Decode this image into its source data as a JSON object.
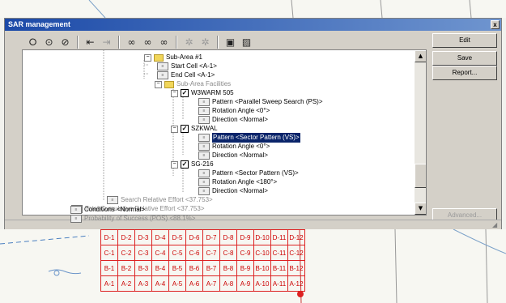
{
  "window": {
    "title": "SAR management",
    "close_glyph": "x"
  },
  "toolbar": {
    "icons": [
      "circle-icon",
      "copy-circle-icon",
      "delete-circle-icon",
      "import-icon",
      "export-icon",
      "binoculars-icon",
      "binoculars-add-icon",
      "binoculars-remove-icon",
      "snowflake-icon",
      "snowflake-dim-icon",
      "panel-icon",
      "panel-edit-icon"
    ]
  },
  "tree": {
    "sub_area": "Sub-Area #1",
    "start_cell": "Start Cell <A-1>",
    "end_cell": "End Cell <A-1>",
    "facilities": "Sub-Area Facilities",
    "f1": {
      "name": "W3WARM 505",
      "pattern": "Pattern <Parallel Sweep Search (PS)>",
      "rotation": "Rotation Angle <0°>",
      "direction": "Direction <Normal>"
    },
    "f2": {
      "name": "SZKWAL",
      "pattern": "Pattern <Sector Pattern (VS)>",
      "rotation": "Rotation Angle <0°>",
      "direction": "Direction <Normal>"
    },
    "f3": {
      "name": "SG-216",
      "pattern": "Pattern <Sector Pattern (VS)>",
      "rotation": "Rotation Angle <180°>",
      "direction": "Direction <Normal>"
    },
    "search_effort": "Search Relative Effort <37.753>",
    "total_effort": "Total Cumulative Relative Effort <37.753>",
    "conditions": "Conditions <Normal>",
    "pos": "Probability of Success (POS) <88.1%>"
  },
  "buttons": {
    "edit": "Edit",
    "save": "Save",
    "report": "Report...",
    "advanced": "Advanced..."
  },
  "grid": {
    "rows": [
      [
        "D-1",
        "D-2",
        "D-3",
        "D-4",
        "D-5",
        "D-6",
        "D-7",
        "D-8",
        "D-9",
        "D-10",
        "D-11",
        "D-12"
      ],
      [
        "C-1",
        "C-2",
        "C-3",
        "C-4",
        "C-5",
        "C-6",
        "C-7",
        "C-8",
        "C-9",
        "C-10",
        "C-11",
        "C-12"
      ],
      [
        "B-1",
        "B-2",
        "B-3",
        "B-4",
        "B-5",
        "B-6",
        "B-7",
        "B-8",
        "B-9",
        "B-10",
        "B-11",
        "B-12"
      ],
      [
        "A-1",
        "A-2",
        "A-3",
        "A-4",
        "A-5",
        "A-6",
        "A-7",
        "A-8",
        "A-9",
        "A-10",
        "A-11",
        "A-12"
      ]
    ]
  }
}
